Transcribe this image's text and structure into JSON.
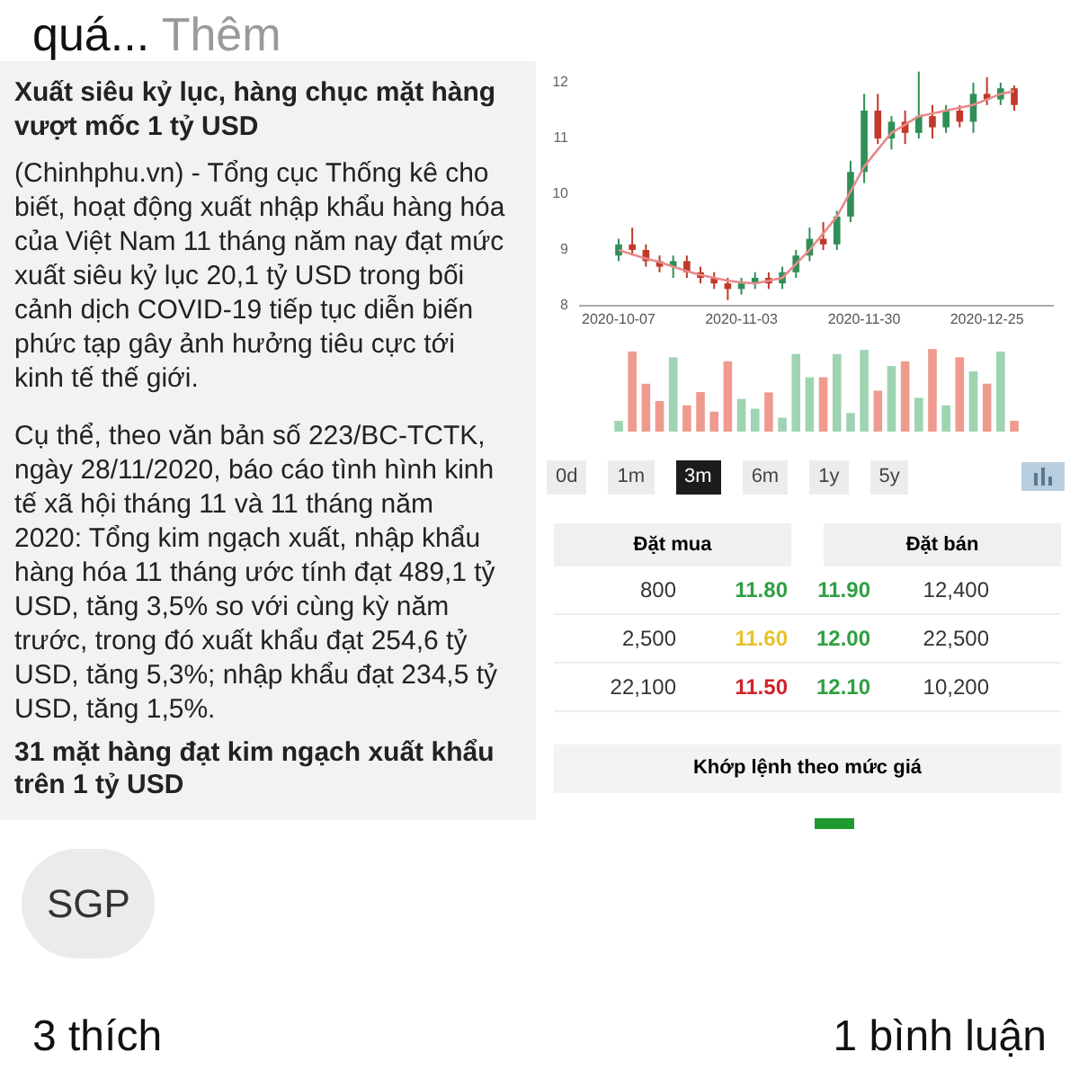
{
  "post": {
    "preview": "quá...",
    "more": "Thêm"
  },
  "article": {
    "title": "Xuất siêu kỷ lục, hàng chục mặt hàng vượt mốc 1 tỷ USD",
    "paragraphs": [
      "(Chinhphu.vn) - Tổng cục Thống kê cho biết, hoạt động xuất nhập khẩu hàng hóa của Việt Nam 11 tháng năm nay đạt mức xuất siêu kỷ lục 20,1 tỷ USD trong bối cảnh dịch COVID-19 tiếp tục diễn biến phức tạp gây ảnh hưởng tiêu cực tới kinh tế thế giới.",
      "Cụ thể, theo văn bản số 223/BC-TCTK, ngày 28/11/2020, báo cáo tình hình kinh tế xã hội tháng 11 và 11 tháng năm 2020: Tổng kim ngạch xuất, nhập khẩu hàng hóa 11 tháng ước tính đạt 489,1 tỷ USD, tăng 3,5% so với cùng kỳ năm trước, trong đó xuất khẩu đạt 254,6 tỷ USD, tăng 5,3%; nhập khẩu đạt 234,5 tỷ USD, tăng 1,5%."
    ],
    "subheading": "31 mặt hàng đạt kim ngạch xuất khẩu trên 1 tỷ USD"
  },
  "chart": {
    "chart_data": {
      "type": "candlestick",
      "categories": [
        "2020-10-07",
        null,
        null,
        null,
        null,
        null,
        null,
        null,
        null,
        "2020-11-03",
        null,
        null,
        null,
        null,
        null,
        null,
        null,
        null,
        "2020-11-30",
        null,
        null,
        null,
        null,
        null,
        null,
        null,
        null,
        "2020-12-25",
        null,
        null
      ],
      "ohlc": [
        [
          8.9,
          9.2,
          8.8,
          9.1
        ],
        [
          9.1,
          9.4,
          8.9,
          9.0
        ],
        [
          9.0,
          9.1,
          8.7,
          8.8
        ],
        [
          8.8,
          8.9,
          8.6,
          8.7
        ],
        [
          8.7,
          8.9,
          8.5,
          8.8
        ],
        [
          8.8,
          8.9,
          8.5,
          8.6
        ],
        [
          8.6,
          8.7,
          8.4,
          8.5
        ],
        [
          8.5,
          8.6,
          8.3,
          8.4
        ],
        [
          8.4,
          8.5,
          8.1,
          8.3
        ],
        [
          8.3,
          8.5,
          8.2,
          8.4
        ],
        [
          8.4,
          8.6,
          8.3,
          8.5
        ],
        [
          8.5,
          8.6,
          8.3,
          8.4
        ],
        [
          8.4,
          8.7,
          8.3,
          8.6
        ],
        [
          8.6,
          9.0,
          8.5,
          8.9
        ],
        [
          8.9,
          9.4,
          8.8,
          9.2
        ],
        [
          9.2,
          9.5,
          9.0,
          9.1
        ],
        [
          9.1,
          9.7,
          9.0,
          9.6
        ],
        [
          9.6,
          10.6,
          9.5,
          10.4
        ],
        [
          10.4,
          11.8,
          10.2,
          11.5
        ],
        [
          11.5,
          11.8,
          10.9,
          11.0
        ],
        [
          11.0,
          11.4,
          10.8,
          11.3
        ],
        [
          11.3,
          11.5,
          10.9,
          11.1
        ],
        [
          11.1,
          12.2,
          11.0,
          11.4
        ],
        [
          11.4,
          11.6,
          11.0,
          11.2
        ],
        [
          11.2,
          11.6,
          11.1,
          11.5
        ],
        [
          11.5,
          11.6,
          11.2,
          11.3
        ],
        [
          11.3,
          12.0,
          11.1,
          11.8
        ],
        [
          11.8,
          12.1,
          11.6,
          11.7
        ],
        [
          11.7,
          12.0,
          11.6,
          11.9
        ],
        [
          11.9,
          11.95,
          11.5,
          11.6
        ]
      ],
      "ylim": [
        8,
        12
      ],
      "yticks": [
        8,
        9,
        10,
        11,
        12
      ],
      "series": [
        {
          "type": "line",
          "color": "#e88a8a",
          "values": [
            9.0,
            8.92,
            8.85,
            8.78,
            8.7,
            8.62,
            8.55,
            8.5,
            8.45,
            8.42,
            8.4,
            8.45,
            8.5,
            8.75,
            9.0,
            9.3,
            9.6,
            10.05,
            10.5,
            10.8,
            11.1,
            11.25,
            11.4,
            11.45,
            11.5,
            11.55,
            11.6,
            11.7,
            11.8,
            11.85
          ]
        }
      ]
    },
    "ranges": [
      {
        "label": "0d",
        "selected": false
      },
      {
        "label": "1m",
        "selected": false
      },
      {
        "label": "3m",
        "selected": true
      },
      {
        "label": "6m",
        "selected": false
      },
      {
        "label": "1y",
        "selected": false
      },
      {
        "label": "5y",
        "selected": false
      }
    ]
  },
  "order_book": {
    "buy_header": "Đặt mua",
    "sell_header": "Đặt bán",
    "rows": [
      {
        "buy_volume": "800",
        "buy_price": {
          "text": "11.80",
          "color": "#2ea043"
        },
        "sell_price": {
          "text": "11.90",
          "color": "#2ea043"
        },
        "sell_volume": "12,400"
      },
      {
        "buy_volume": "2,500",
        "buy_price": {
          "text": "11.60",
          "color": "#e6c229"
        },
        "sell_price": {
          "text": "12.00",
          "color": "#2ea043"
        },
        "sell_volume": "22,500"
      },
      {
        "buy_volume": "22,100",
        "buy_price": {
          "text": "11.50",
          "color": "#d0232b"
        },
        "sell_price": {
          "text": "12.10",
          "color": "#2ea043"
        },
        "sell_volume": "10,200"
      }
    ],
    "match_title": "Khớp lệnh theo mức giá"
  },
  "tag": "SGP",
  "likes": "3 thích",
  "comments": "1 bình luận"
}
